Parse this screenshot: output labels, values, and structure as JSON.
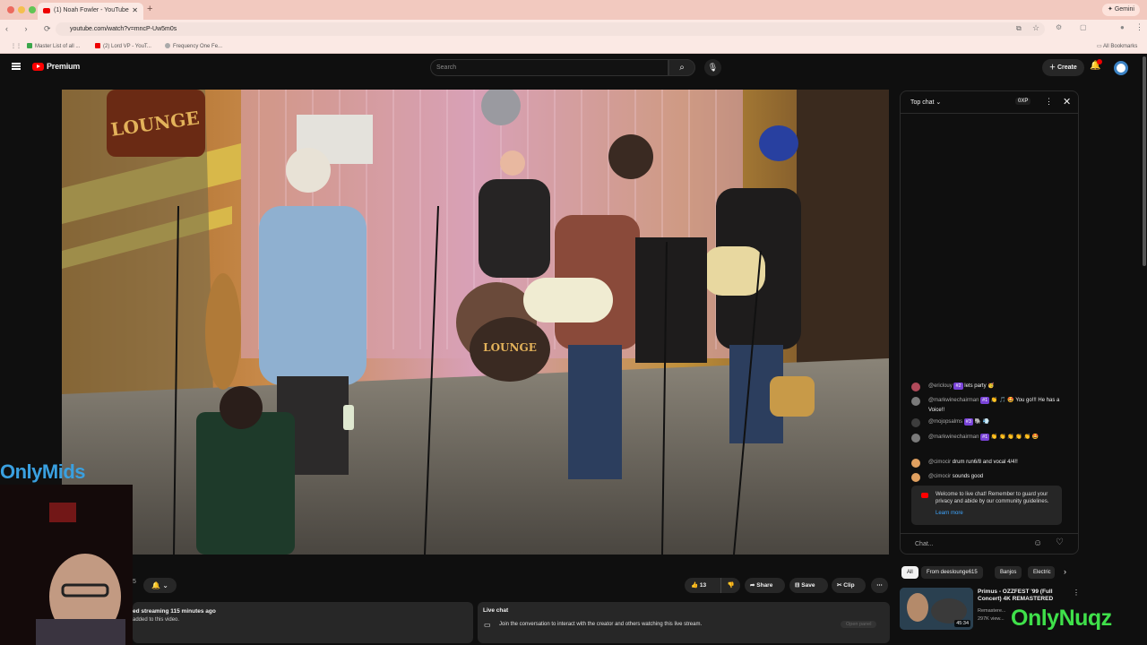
{
  "browser": {
    "tab_title": "(1) Noah Fowler - YouTube",
    "url": "youtube.com/watch?v=mncP-Uw5m0s",
    "gemini_label": "Gemini",
    "bookmarks": [
      "Master List of all ...",
      "(2) Lord VP - YouT...",
      "Frequency One Fe..."
    ],
    "all_bookmarks_label": "All Bookmarks"
  },
  "youtube": {
    "logo_text": "Premium",
    "search_placeholder": "Search",
    "create_label": "Create",
    "notification_count": "",
    "colors": {
      "brand_red": "#ff0000",
      "background": "#0f0f0f",
      "badge_purple": "#7842d6",
      "link_blue": "#3ea6ff"
    }
  },
  "video": {
    "stage_sign": "Dee's LOUNGE",
    "drum_text": "Dee's LOUNGE"
  },
  "actions": {
    "likes": "13",
    "share_label": "Share",
    "save_label": "Save",
    "clip_label": "Clip",
    "subs_fragment": "5"
  },
  "description": {
    "line1": "ed streaming 115 minutes ago",
    "line2": "added to this video."
  },
  "live_chat_card": {
    "title": "Live chat",
    "text": "Join the conversation to interact with the creator and others watching this live stream.",
    "open_panel": "Open panel"
  },
  "chat": {
    "mode_label": "Top chat",
    "xp_label": "0XP",
    "messages": [
      {
        "user": "@ericlouy",
        "badge": "#2",
        "text": "lets party 🥳",
        "avatar_color": "#b04a5a"
      },
      {
        "user": "@markwinechairman",
        "badge": "#1",
        "text": "👏 🎵 🤩 You go!!! He has a Voice!!",
        "avatar_color": "#7a7a7a"
      },
      {
        "user": "@mojopsalms",
        "badge": "#3",
        "text": "🐘 💨",
        "avatar_color": "#3d3d3d"
      },
      {
        "user": "@markwinechairman",
        "badge": "#1",
        "text": "👏 👏 👏 👏 👏 🤩",
        "avatar_color": "#7a7a7a"
      },
      {
        "user": "@cimocir",
        "badge": "",
        "text": "drum run6/8 and vocal 4/4!!",
        "avatar_color": "#e0a060"
      },
      {
        "user": "@cimocir",
        "badge": "",
        "text": "sounds good",
        "avatar_color": "#e0a060"
      }
    ],
    "welcome_text": "Welcome to live chat! Remember to guard your privacy and abide by our community guidelines.",
    "learn_more": "Learn more",
    "input_placeholder": "Chat..."
  },
  "chips": [
    "All",
    "From deeslounge615",
    "Banjos",
    "Electric"
  ],
  "recommended": {
    "title": "Primus - OZZFEST '99 (Full Concert) 4K REMASTERED",
    "channel": "Remastere...",
    "views": "297K view...",
    "duration": "45:34"
  },
  "overlays": {
    "left_logo": "OnlyMids",
    "right_logo": "OnlyNuqz"
  }
}
